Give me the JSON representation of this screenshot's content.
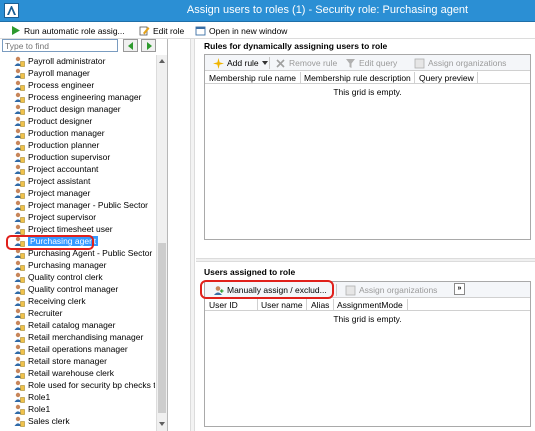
{
  "window": {
    "title": "Assign users to roles (1) - Security role: Purchasing agent"
  },
  "toolbar": {
    "run_label": "Run automatic role assig...",
    "edit_label": "Edit role",
    "open_label": "Open in new window"
  },
  "left": {
    "find_placeholder": "Type to find",
    "roles": [
      "Payroll administrator",
      "Payroll manager",
      "Process engineer",
      "Process engineering manager",
      "Product design manager",
      "Product designer",
      "Production manager",
      "Production planner",
      "Production supervisor",
      "Project accountant",
      "Project assistant",
      "Project manager",
      "Project manager - Public Sector",
      "Project supervisor",
      "Project timesheet user",
      "Purchasing agent",
      "Purchasing Agent - Public Sector",
      "Purchasing manager",
      "Quality control clerk",
      "Quality control manager",
      "Receiving clerk",
      "Recruiter",
      "Retail catalog manager",
      "Retail merchandising manager",
      "Retail operations manager",
      "Retail store manager",
      "Retail warehouse clerk",
      "Role used for security bp checks tes",
      "Role1",
      "Role1",
      "Sales clerk"
    ],
    "selected_index": 15
  },
  "rules": {
    "title": "Rules for dynamically assigning users to role",
    "add_label": "Add rule",
    "remove_label": "Remove rule",
    "edit_query_label": "Edit query",
    "assign_org_label": "Assign organizations",
    "columns": [
      "Membership rule name",
      "Membership rule description",
      "Query preview"
    ],
    "empty_text": "This grid is empty."
  },
  "users": {
    "title": "Users assigned to role",
    "manual_label": "Manually assign / exclud...",
    "assign_org_label": "Assign organizations",
    "more_label": "»",
    "columns": [
      "User ID",
      "User name",
      "Alias",
      "AssignmentMode"
    ],
    "empty_text": "This grid is empty."
  },
  "colors": {
    "titlebar": "#2b8fd4",
    "selection": "#3399ff",
    "highlight_ring": "#e0201b"
  }
}
